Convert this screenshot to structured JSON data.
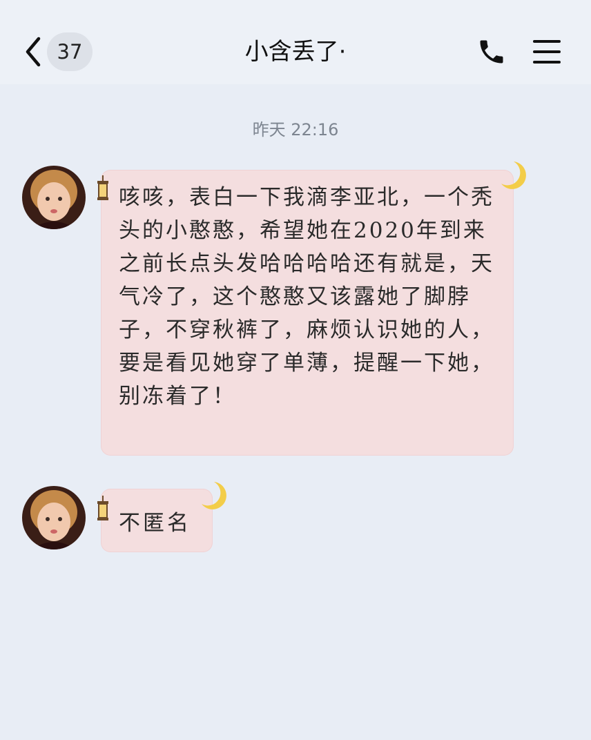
{
  "header": {
    "back_icon": "chevron-left-icon",
    "unread_count": "37",
    "title": "小含丢了·",
    "call_icon": "phone-icon",
    "menu_icon": "menu-icon"
  },
  "chat": {
    "timestamp": "昨天 22:16",
    "messages": [
      {
        "sender": "contact",
        "text": "咳咳，表白一下我滴李亚北，一个秃头的小憨憨，希望她在2020年到来之前长点头发哈哈哈哈还有就是，天气冷了，这个憨憨又该露她了脚脖子，不穿秋裤了，麻烦认识她的人，要是看见她穿了单薄，提醒一下她，别冻着了！"
      },
      {
        "sender": "contact",
        "text": "不匿名"
      }
    ]
  },
  "colors": {
    "background": "#e8edf5",
    "header_bg": "#edf1f7",
    "bubble": "#f4dedf",
    "moon": "#f3cd49"
  }
}
